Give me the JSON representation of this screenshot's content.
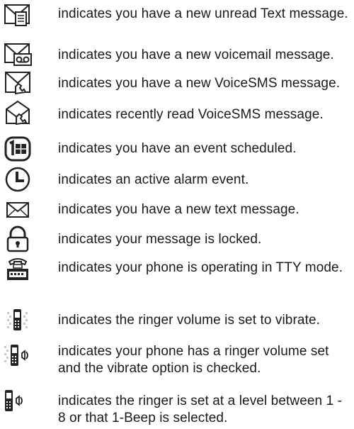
{
  "entries": [
    {
      "icon": "new-text-message-icon",
      "text": "indicates you have a new unread Text message."
    },
    {
      "icon": "voicemail-icon",
      "text": "indicates you have a new voicemail message."
    },
    {
      "icon": "new-voicesms-icon",
      "text": "indicates you have a new VoiceSMS message."
    },
    {
      "icon": "read-voicesms-icon",
      "text": "indicates recently read VoiceSMS message."
    },
    {
      "icon": "event-scheduled-icon",
      "text": "indicates you have an event scheduled."
    },
    {
      "icon": "alarm-clock-icon",
      "text": "indicates an active alarm event."
    },
    {
      "icon": "envelope-icon",
      "text": "indicates you have a new text message."
    },
    {
      "icon": "lock-icon",
      "text": "indicates your message is locked."
    },
    {
      "icon": "tty-icon",
      "text": "indicates your phone is operating in TTY mode."
    },
    {
      "icon": "vibrate-icon",
      "text": "indicates the ringer volume is set to vibrate."
    },
    {
      "icon": "ringer-vibrate-icon",
      "text": "indicates your phone has a ringer volume set and the vibrate option is checked."
    },
    {
      "icon": "ringer-icon",
      "text": "indicates the ringer is set at a level between 1 - 8 or that 1-Beep is selected."
    }
  ]
}
